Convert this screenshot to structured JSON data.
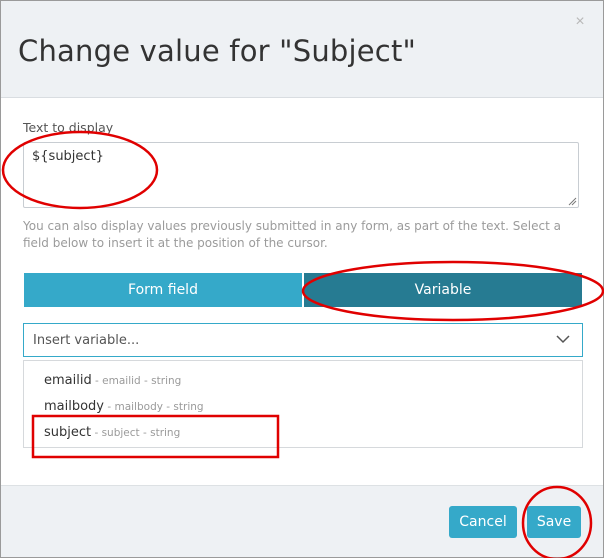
{
  "dialog": {
    "title": "Change value for \"Subject\"",
    "close_glyph": "×"
  },
  "text_field": {
    "label": "Text to display",
    "value": "${subject}",
    "help": "You can also display values previously submitted in any form, as part of the text. Select a field below to insert it at the position of the cursor."
  },
  "tabs": [
    {
      "label": "Form field",
      "active": false
    },
    {
      "label": "Variable",
      "active": true
    }
  ],
  "variable_select": {
    "placeholder": "Insert variable...",
    "options": [
      {
        "name": "emailid",
        "meta": " - emailid - string"
      },
      {
        "name": "mailbody",
        "meta": " - mailbody - string"
      },
      {
        "name": "subject",
        "meta": " - subject - string"
      }
    ]
  },
  "footer": {
    "cancel_label": "Cancel",
    "save_label": "Save"
  },
  "colors": {
    "accent": "#35a9c9",
    "accent_dark": "#267b92",
    "annotation": "#e00000"
  },
  "icons": {
    "close": "close-icon",
    "dropdown": "chevron-down-icon",
    "resize": "resize-grip-icon"
  }
}
